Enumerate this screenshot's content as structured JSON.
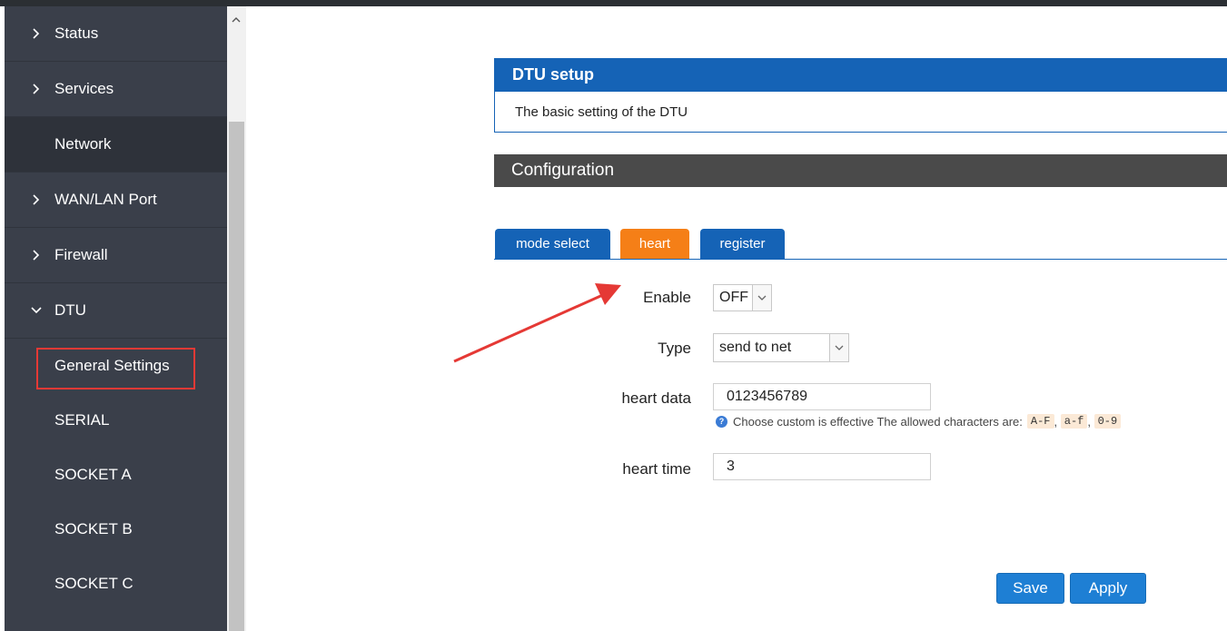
{
  "sidebar": {
    "items": [
      {
        "label": "Status",
        "chevron": "right"
      },
      {
        "label": "Services",
        "chevron": "right"
      },
      {
        "label": "Network",
        "chevron": ""
      },
      {
        "label": "WAN/LAN Port",
        "chevron": "right"
      },
      {
        "label": "Firewall",
        "chevron": "right"
      },
      {
        "label": "DTU",
        "chevron": "down"
      },
      {
        "label": "General Settings",
        "chevron": "",
        "highlighted": true
      },
      {
        "label": "SERIAL",
        "chevron": ""
      },
      {
        "label": "SOCKET A",
        "chevron": ""
      },
      {
        "label": "SOCKET B",
        "chevron": ""
      },
      {
        "label": "SOCKET C",
        "chevron": ""
      }
    ]
  },
  "main": {
    "section_title": "DTU setup",
    "section_desc": "The basic setting of the DTU",
    "config_title": "Configuration",
    "tabs": [
      {
        "label": "mode select",
        "active": false
      },
      {
        "label": "heart",
        "active": true
      },
      {
        "label": "register",
        "active": false
      }
    ],
    "form": {
      "enable_label": "Enable",
      "enable_value": "OFF",
      "type_label": "Type",
      "type_value": "send to net",
      "heart_data_label": "heart data",
      "heart_data_value": "0123456789",
      "hint_text": "Choose custom is effective The allowed characters are:",
      "hint_codes": [
        "A-F",
        "a-f",
        "0-9"
      ],
      "heart_time_label": "heart time",
      "heart_time_value": "3"
    },
    "buttons": {
      "save": "Save",
      "apply": "Apply"
    }
  },
  "colors": {
    "sidebar_bg": "#3a3f4a",
    "primary_blue": "#1563b6",
    "active_tab": "#f57f17",
    "config_header": "#4a4a4a",
    "highlight_box": "#e53935",
    "annotation_arrow": "#e53935"
  }
}
